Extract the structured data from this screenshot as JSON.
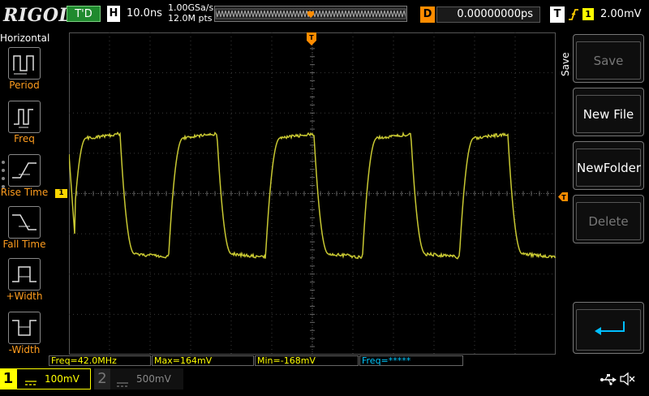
{
  "topbar": {
    "brand": "RIGOL",
    "status": "T'D",
    "horizontal_label": "H",
    "timebase": "10.0ns",
    "sample_rate": "1.00GSa/s",
    "memory_depth": "12.0M pts",
    "delay_label": "D",
    "delay_value": "0.00000000ps",
    "trigger_label": "T",
    "trigger_source": "1",
    "trigger_level": "2.00mV"
  },
  "left_menu": {
    "title": "Horizontal",
    "items": [
      {
        "label": "Period",
        "icon": "period-icon"
      },
      {
        "label": "Freq",
        "icon": "freq-icon"
      },
      {
        "label": "Rise Time",
        "icon": "rise-time-icon"
      },
      {
        "label": "Fall Time",
        "icon": "fall-time-icon"
      },
      {
        "label": "+Width",
        "icon": "positive-width-icon"
      },
      {
        "label": "-Width",
        "icon": "negative-width-icon"
      }
    ]
  },
  "channel1_marker": "1",
  "measurements": [
    {
      "text": "Freq=42.0MHz",
      "color": "#ffff00"
    },
    {
      "text": "Max=164mV",
      "color": "#ffff00"
    },
    {
      "text": "Min=-168mV",
      "color": "#ffff00"
    },
    {
      "text": "Freq=*****",
      "color": "#00c8ff"
    }
  ],
  "right_menu": {
    "title": "Save",
    "buttons": [
      {
        "label": "Save",
        "enabled": false
      },
      {
        "label": "New File",
        "enabled": true
      },
      {
        "label": "NewFolder",
        "enabled": true
      },
      {
        "label": "Delete",
        "enabled": false
      }
    ],
    "back_icon": "return-arrow-icon"
  },
  "bottombar": {
    "ch1_label": "1",
    "ch1_scale": "100mV",
    "ch2_label": "2",
    "ch2_scale": "500mV"
  },
  "colors": {
    "ch1": "#ffff00",
    "trace": "#c8c832",
    "orange": "#ff8c00"
  }
}
